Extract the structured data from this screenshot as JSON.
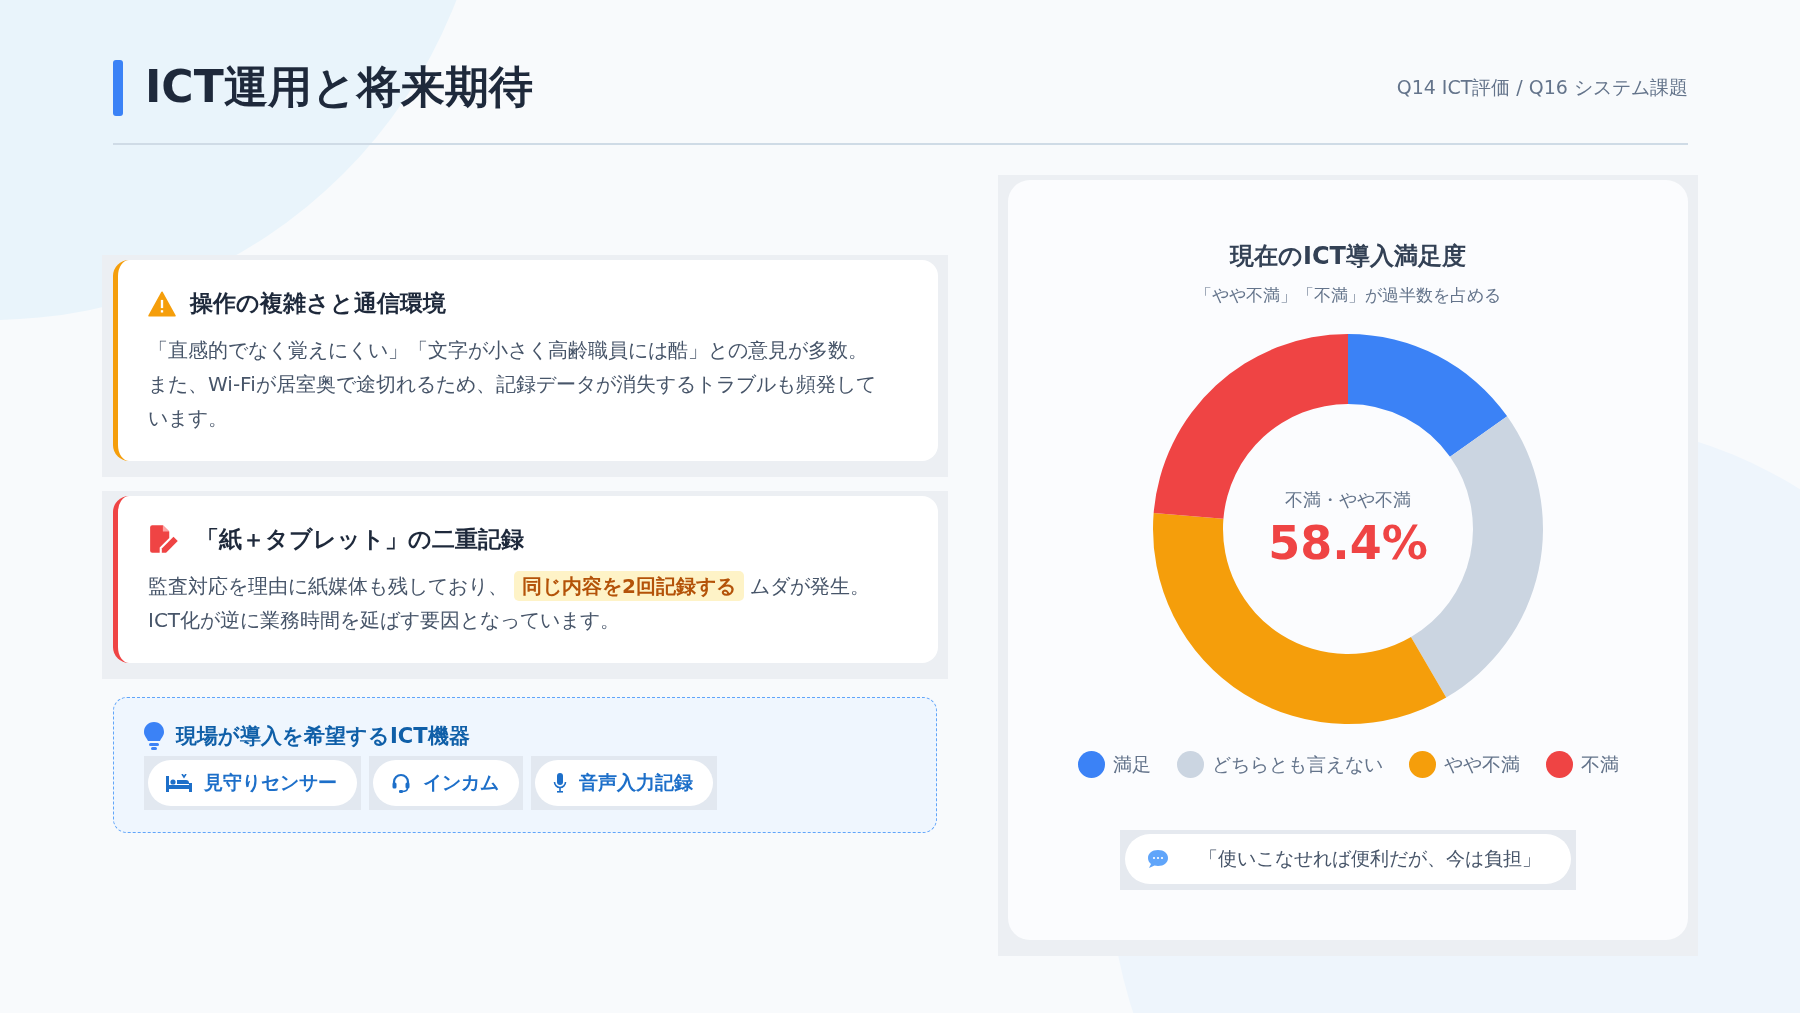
{
  "header": {
    "title": "ICT運用と将来期待",
    "source": "Q14 ICT評価 / Q16 システム課題"
  },
  "issues": [
    {
      "kind": "warning",
      "title": "操作の複雑さと通信環境",
      "body": "「直感的でなく覚えにくい」「文字が小さく高齢職員には酷」との意見が多数。また、Wi-Fiが居室奥で途切れるため、記録データが消失するトラブルも頻発しています。"
    },
    {
      "kind": "document",
      "title": "「紙＋タブレット」の二重記録",
      "body": "監査対応を理由に紙媒体も残しており、**同じ内容を2回記録する**ムダが発生。ICT化が逆に業務時間を延ばす要因となっています。"
    }
  ],
  "wishlist": {
    "title": "現場が導入を希望するICT機器",
    "items": [
      {
        "kind": "bed",
        "label": "見守りセンサー"
      },
      {
        "kind": "headset",
        "label": "インカム"
      },
      {
        "kind": "mic",
        "label": "音声入力記録"
      }
    ]
  },
  "satisfaction": {
    "title": "現在のICT導入満足度",
    "subtitle": "「やや不満」「不満」が過半数を占める",
    "center_label": "不満・やや不満",
    "center_value": "58.4%",
    "chart_data": {
      "type": "donut",
      "categories": [
        "満足",
        "どちらとも言えない",
        "やや不満",
        "不満"
      ],
      "series": [
        {
          "colors": [
            "#3b82f6",
            "#cbd5e1",
            "#f59e0b",
            "#ef4444"
          ],
          "values": [
            15.2,
            26.4,
            34.7,
            23.7
          ]
        }
      ]
    },
    "quote": "「使いこなせれば便利だが、今は負担」"
  }
}
